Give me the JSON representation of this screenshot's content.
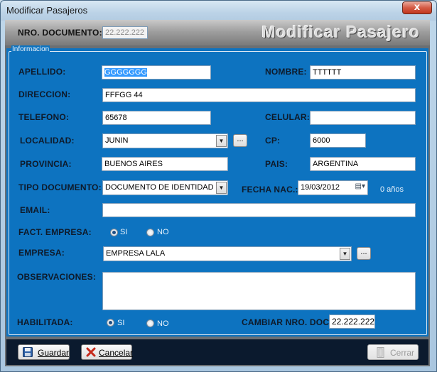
{
  "window": {
    "title": "Modificar Pasajeros",
    "close_label": "x"
  },
  "header": {
    "nro_documento_label": "NRO. DOCUMENTO:",
    "nro_documento_value": "22.222.222",
    "banner": "Modificar Pasajero"
  },
  "group": {
    "title": "Informacion"
  },
  "form": {
    "apellido_label": "APELLIDO:",
    "apellido_value": "GGGGGGG",
    "nombre_label": "NOMBRE:",
    "nombre_value": "TTTTTT",
    "direccion_label": "DIRECCION:",
    "direccion_value": "FFFGG 44",
    "telefono_label": "TELEFONO:",
    "telefono_value": "65678",
    "celular_label": "CELULAR:",
    "celular_value": "",
    "localidad_label": "LOCALIDAD:",
    "localidad_value": "JUNIN",
    "localidad_more": "...",
    "cp_label": "CP:",
    "cp_value": "6000",
    "provincia_label": "PROVINCIA:",
    "provincia_value": "BUENOS AIRES",
    "pais_label": "PAIS:",
    "pais_value": "ARGENTINA",
    "tipo_documento_label": "TIPO DOCUMENTO:",
    "tipo_documento_value": "DOCUMENTO DE IDENTIDAD FE",
    "fecha_nac_label": "FECHA NAC.:",
    "fecha_nac_value": "19/03/2012",
    "edad_text": "0 años",
    "email_label": "EMAIL:",
    "email_value": "",
    "fact_empresa_label": "FACT. EMPRESA:",
    "fact_si": "SI",
    "fact_no": "NO",
    "fact_selected": "SI",
    "empresa_label": "EMPRESA:",
    "empresa_value": "EMPRESA LALA",
    "empresa_more": "...",
    "observaciones_label": "OBSERVACIONES:",
    "observaciones_value": "",
    "habilitada_label": "HABILITADA:",
    "habilitada_si": "SI",
    "habilitada_no": "NO",
    "habilitada_selected": "SI",
    "cambiar_nro_doc_label": "CAMBIAR NRO. DOC:",
    "cambiar_nro_doc_value": "22.222.222"
  },
  "footer": {
    "guardar_label": "Guardar",
    "cancelar_label": "Cancelar",
    "cerrar_label": "Cerrar"
  },
  "colors": {
    "panel_blue": "#0d73c0",
    "footer_dark": "#0b1a2e",
    "selection_blue": "#3399ff"
  }
}
